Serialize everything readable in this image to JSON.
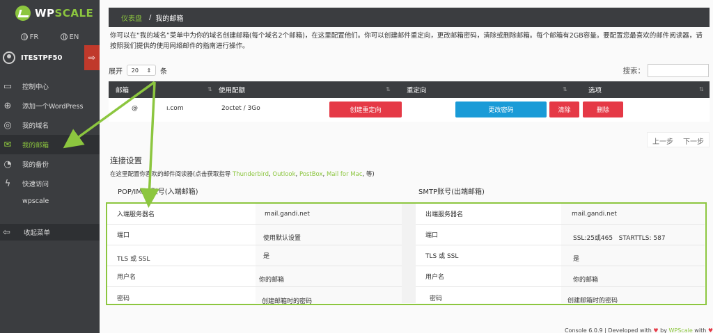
{
  "brand": {
    "name_part1": "WP",
    "name_part2": "SCALE"
  },
  "langs": [
    {
      "label": "FR"
    },
    {
      "label": "EN"
    }
  ],
  "user": {
    "name": "ITESTPF50"
  },
  "nav": {
    "items": [
      {
        "label": "控制中心",
        "icon": "monitor-icon"
      },
      {
        "label": "添加一个WordPress",
        "icon": "plus-icon"
      },
      {
        "label": "我的域名",
        "icon": "globe-icon"
      },
      {
        "label": "我的邮箱",
        "icon": "envelope-icon"
      },
      {
        "label": "我的备份",
        "icon": "backup-icon"
      },
      {
        "label": "快速访问",
        "icon": "bolt-icon"
      }
    ],
    "sub_item": "wpscale",
    "collapse": "收起菜单"
  },
  "breadcrumb": {
    "home": "仪表盘",
    "sep": "/",
    "current": "我的邮箱"
  },
  "intro": "你可以在“我的域名”菜单中为你的域名创建邮箱(每个域名2个邮箱)，在这里配置他们。你可以创建邮件重定向，更改邮箱密码，清除或删除邮箱。每个邮箱有2GB容量。要配置您最喜欢的邮件阅读器，请按照我们提供的使用网络邮件的指南进行操作。",
  "table_controls": {
    "show_label": "展开",
    "page_size": "20",
    "unit_label": "条",
    "search_label": "搜索："
  },
  "table": {
    "headers": [
      "邮箱",
      "使用配额",
      "重定向",
      "选项"
    ],
    "row": {
      "email_at": "@",
      "email_domain": "ı.com",
      "quota": "2octet / 3Go",
      "redirect_button": "创建重定向",
      "change_password": "更改密码",
      "clear": "清除",
      "delete": "删除"
    }
  },
  "pager": {
    "prev": "上一步",
    "next": "下一步"
  },
  "connection": {
    "title": "连接设置",
    "subtitle_prefix": "在这里配置你喜欢的邮件阅读器(点击获取指导 ",
    "links": [
      "Thunderbird",
      "Outlook",
      "PostBox",
      "Mail for Mac"
    ],
    "subtitle_suffix": ", 等)",
    "pop_title": "POP/IMAP账号(入端邮箱)",
    "smtp_title": "SMTP账号(出端邮箱)",
    "pop_rows": [
      {
        "label": "入端服务器名",
        "value": "mail.gandi.net"
      },
      {
        "label": "端口",
        "value": "使用默认设置"
      },
      {
        "label": "TLS 或 SSL",
        "value": "是"
      },
      {
        "label": "用户名",
        "value": "你的邮箱"
      },
      {
        "label": "密码",
        "value": "创建邮箱时的密码"
      }
    ],
    "smtp_rows": [
      {
        "label": "出端服务器名",
        "value": "mail.gandi.net"
      },
      {
        "label": "端口",
        "value": "SSL:25或465   STARTTLS: 587"
      },
      {
        "label": "TLS 或 SSL",
        "value": "是"
      },
      {
        "label": "用户名",
        "value": "你的邮箱"
      },
      {
        "label": "密码",
        "value": "创建邮箱时的密码"
      }
    ]
  },
  "footer": {
    "text": "Console 6.0.9 | Developed with",
    "by": "by",
    "brand": "WPScale",
    "with": "with"
  },
  "colors": {
    "accent": "#8cc63f",
    "dark": "#3b3d40",
    "red": "#e53946",
    "blue": "#1a9bd7"
  }
}
